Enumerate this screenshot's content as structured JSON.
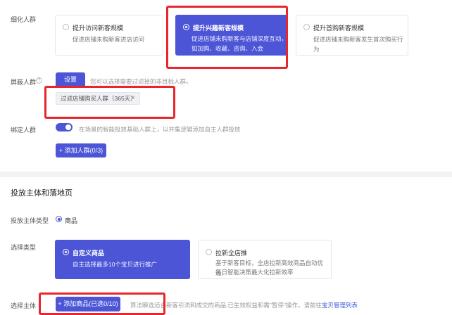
{
  "audience": {
    "label": "细化人群",
    "options": [
      {
        "title": "提升访问新客规模",
        "desc": "促进店铺未购新客进店访问",
        "selected": false
      },
      {
        "title": "提升兴趣新客规模",
        "desc1": "促进店铺未购新客与店铺深度互动，",
        "desc2": "如加购、收藏、咨询、入会",
        "selected": true
      },
      {
        "title": "提升首购新客规模",
        "desc": "促进店铺未购新客发生首次购买行为",
        "selected": false
      }
    ]
  },
  "exclude": {
    "label": "屏蔽人群",
    "button": "设置",
    "hint": "您可以选择需要过滤掉的非目标人群。",
    "tag": "过滤店铺购买人群（365天）"
  },
  "bind": {
    "label": "绑定人群",
    "hint": "在场景的智能投放基础人群上，以并集逻辑添加自主人群投放",
    "add_button": "+ 添加人群(0/3)"
  },
  "section": {
    "title": "投放主体和落地页"
  },
  "subject_type": {
    "label": "投放主体类型",
    "value": "商品"
  },
  "select_type": {
    "label": "选择类型",
    "options": [
      {
        "title": "自定义商品",
        "desc": "自主选择最多10个宝贝进行推广",
        "selected": true
      },
      {
        "title": "拉新全店推",
        "desc1": "基于新客目标，全店拉新高效商品自动优选，",
        "desc2": "每日智能决策最大化拉新效率",
        "selected": false
      }
    ]
  },
  "subject": {
    "label": "选择主体",
    "add_button": "+ 添加商品(已选0/10)",
    "hint": "算法瞬选适合新客引流和成交的商品;已生效权益和需\"暂停\"操作，请前往",
    "link": "宝贝管理列表"
  }
}
